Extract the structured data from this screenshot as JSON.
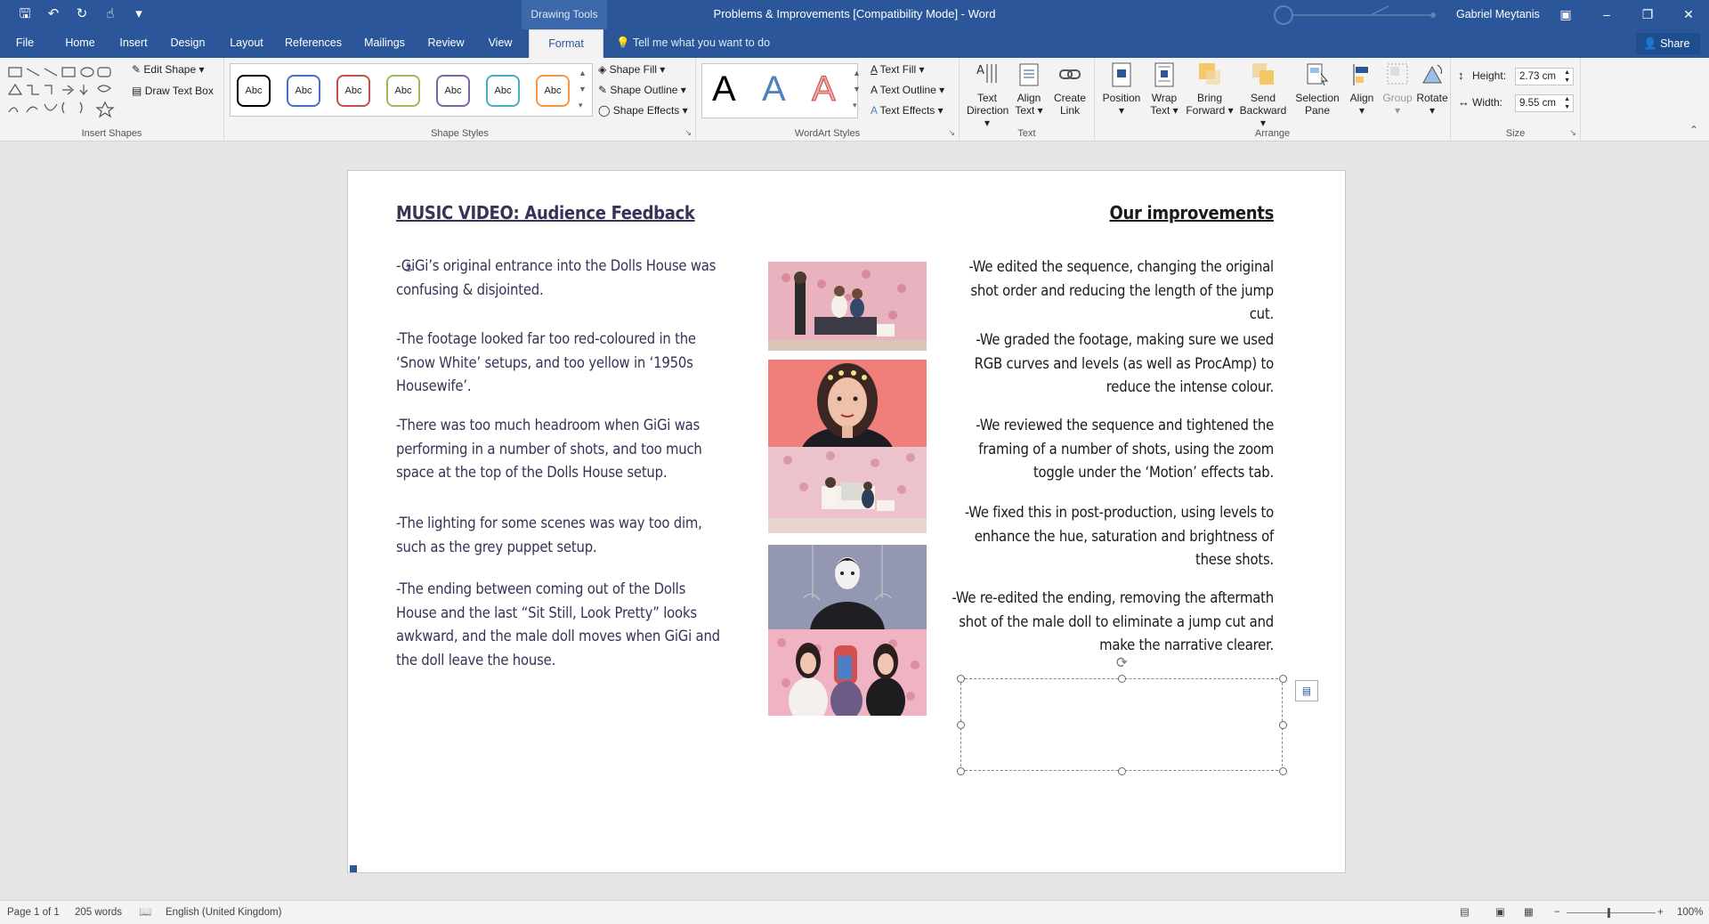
{
  "window": {
    "app_title": "Problems & Improvements [Compatibility Mode]  -  Word",
    "context_tab_label": "Drawing Tools",
    "user_name": "Gabriel Meytanis"
  },
  "quick_access": [
    "save-icon",
    "undo-icon",
    "redo-icon",
    "touch-mode-icon",
    "customize-icon"
  ],
  "tabs": [
    "File",
    "Home",
    "Insert",
    "Design",
    "Layout",
    "References",
    "Mailings",
    "Review",
    "View",
    "Format"
  ],
  "active_tab": "Format",
  "tell_me": "Tell me what you want to do",
  "share_label": "Share",
  "ribbon": {
    "insert_shapes": {
      "label": "Insert Shapes",
      "edit_shape": "Edit Shape",
      "draw_text_box": "Draw Text Box"
    },
    "shape_styles": {
      "label": "Shape Styles",
      "style_text": "Abc",
      "fill": "Shape Fill",
      "outline": "Shape Outline",
      "effects": "Shape Effects"
    },
    "wordart_styles": {
      "label": "WordArt Styles",
      "letter": "A",
      "text_fill": "Text Fill",
      "text_outline": "Text Outline",
      "text_effects": "Text Effects"
    },
    "text": {
      "label": "Text",
      "direction_1": "Text",
      "direction_2": "Direction",
      "align_1": "Align",
      "align_2": "Text",
      "link_1": "Create",
      "link_2": "Link"
    },
    "arrange": {
      "label": "Arrange",
      "position": "Position",
      "wrap_1": "Wrap",
      "wrap_2": "Text",
      "fwd_1": "Bring",
      "fwd_2": "Forward",
      "back_1": "Send",
      "back_2": "Backward",
      "sel_1": "Selection",
      "sel_2": "Pane",
      "align": "Align",
      "group": "Group",
      "rotate": "Rotate"
    },
    "size": {
      "label": "Size",
      "height_label": "Height:",
      "height_value": "2.73 cm",
      "width_label": "Width:",
      "width_value": "9.55 cm"
    }
  },
  "document": {
    "left_heading": "MUSIC VIDEO: Audience Feedback",
    "right_heading": "Our improvements",
    "problems": [
      "-GiGi’s original entrance into the Dolls House was confusing & disjointed.",
      "-The footage looked far too red-coloured in the ‘Snow White’ setups, and too yellow in ‘1950s Housewife’.",
      "-There was too much headroom when GiGi was performing in a number of shots, and too much space at the top of the Dolls House setup.",
      "-The lighting for some scenes was way too dim, such as the grey puppet setup.",
      "-The ending between coming out of the Dolls House and the last “Sit Still, Look Pretty” looks awkward, and the male doll moves when GiGi and the doll leave the house."
    ],
    "improvements": [
      "-We edited the sequence, changing the original shot order and reducing the length of the jump cut.",
      "-We graded the footage, making sure we used RGB curves and levels (as well as ProcAmp) to reduce the intense colour.",
      "-We reviewed the sequence and tightened the framing of a number of shots, using the zoom toggle under the ‘Motion’ effects tab.",
      "-We fixed this in post-production, using levels to enhance the hue, saturation and brightness of these shots.",
      "-We re-edited the ending, removing the aftermath shot of the male doll to eliminate a jump cut and make the narrative clearer."
    ]
  },
  "status": {
    "page": "Page 1 of 1",
    "words": "205 words",
    "language": "English (United Kingdom)",
    "zoom": "100%"
  }
}
